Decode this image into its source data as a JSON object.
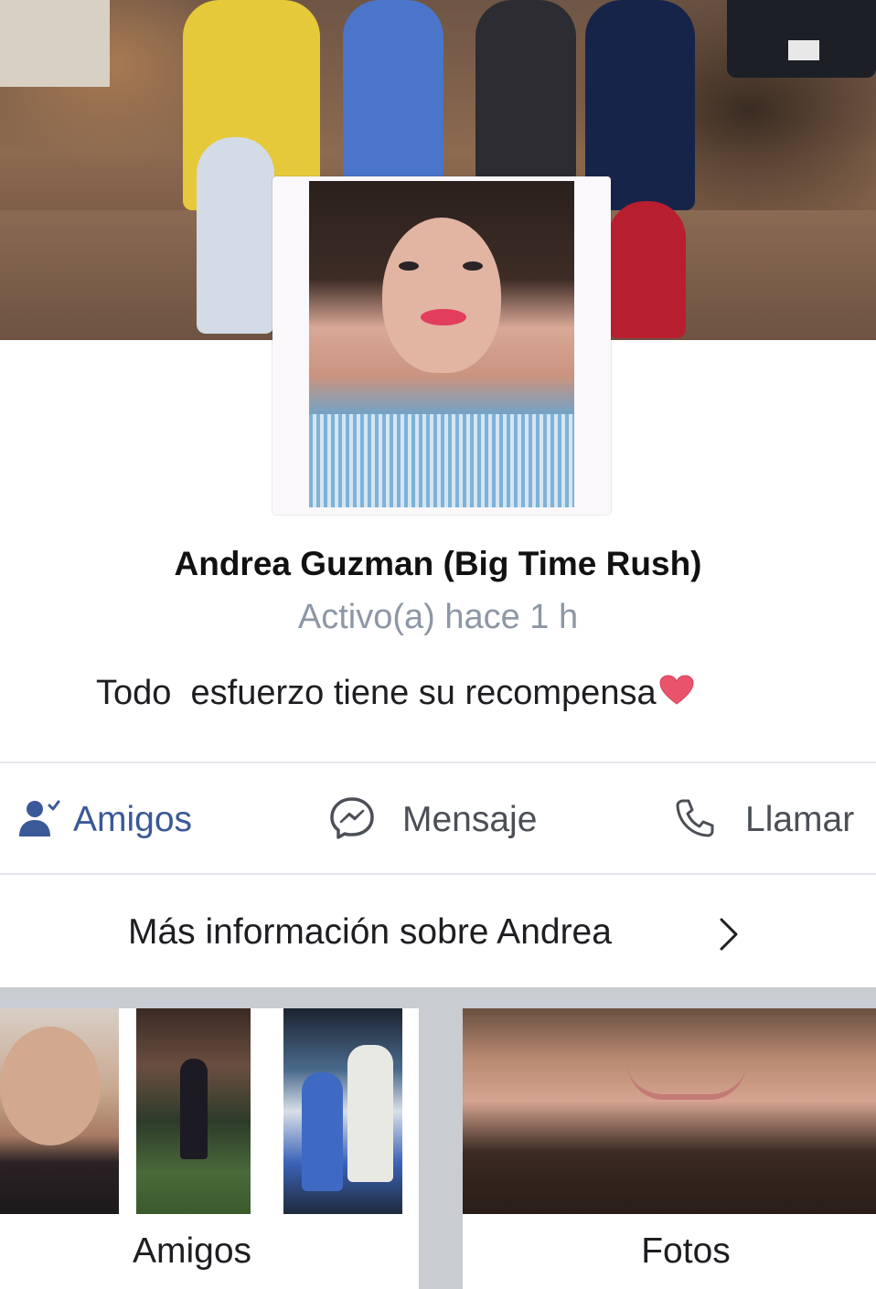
{
  "profile": {
    "name": "Andrea Guzman (Big Time Rush)",
    "status": "Activo(a) hace 1 h",
    "bio": "Todo  esfuerzo tiene su recompensa"
  },
  "actions": {
    "friends": {
      "label": "Amigos",
      "icon": "friend-check-icon"
    },
    "message": {
      "label": "Mensaje",
      "icon": "messenger-icon"
    },
    "call": {
      "label": "Llamar",
      "icon": "phone-icon"
    }
  },
  "more_info": {
    "label": "Más información sobre Andrea",
    "icon": "chevron-right-icon"
  },
  "sections": {
    "friends_label": "Amigos",
    "photos_label": "Fotos"
  },
  "colors": {
    "accent": "#3b5998",
    "muted": "#8d97a5",
    "text": "#1c1e21",
    "divider": "#e4e6eb",
    "gray_bg": "#c9ccd1"
  }
}
